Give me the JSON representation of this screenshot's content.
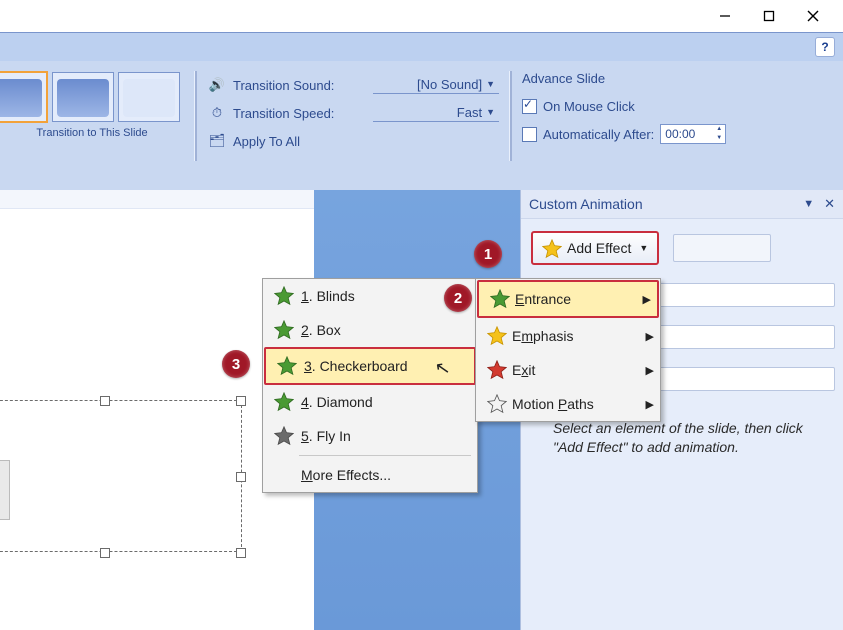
{
  "ribbon": {
    "group_label": "Transition to This Slide",
    "transition_sound_label": "Transition Sound:",
    "transition_sound_value": "[No Sound]",
    "transition_speed_label": "Transition Speed:",
    "transition_speed_value": "Fast",
    "apply_all": "Apply To All",
    "advance_heading": "Advance Slide",
    "on_mouse": "On Mouse Click",
    "auto_after": "Automatically After:",
    "auto_value": "00:00"
  },
  "task_pane": {
    "title": "Custom Animation",
    "add_effect": "Add Effect",
    "hint": "Select an element of the slide, then click \"Add Effect\" to add animation."
  },
  "effect_menu": {
    "entrance": "Entrance",
    "emphasis": "Emphasis",
    "exit": "Exit",
    "motion": "Motion Paths"
  },
  "sub_menu": {
    "i1": "1. Blinds",
    "i2": "2. Box",
    "i3": "3. Checkerboard",
    "i4": "4. Diamond",
    "i5": "5. Fly In",
    "more": "More Effects..."
  },
  "glyph": {
    "n": "n",
    "help": "?"
  },
  "badge": {
    "b1": "1",
    "b2": "2",
    "b3": "3"
  }
}
